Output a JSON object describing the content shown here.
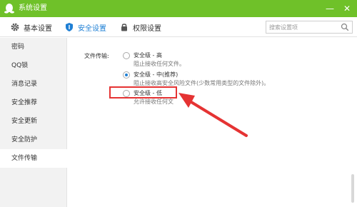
{
  "window": {
    "title": "系统设置",
    "minimize_label": "—",
    "close_label": "✕"
  },
  "tabs": [
    {
      "label": "基本设置",
      "icon": "gear-icon",
      "active": false
    },
    {
      "label": "安全设置",
      "icon": "shield-icon",
      "active": true
    },
    {
      "label": "权限设置",
      "icon": "lock-icon",
      "active": false
    }
  ],
  "search": {
    "placeholder": "搜索设置项"
  },
  "sidebar": {
    "items": [
      {
        "label": "密码"
      },
      {
        "label": "QQ锁"
      },
      {
        "label": "消息记录"
      },
      {
        "label": "安全推荐"
      },
      {
        "label": "安全更新"
      },
      {
        "label": "安全防护"
      },
      {
        "label": "文件传输",
        "active": true
      }
    ]
  },
  "file_transfer": {
    "label": "文件传输:",
    "options": [
      {
        "title": "安全级 - 高",
        "desc": "阻止接收任何文件。",
        "checked": false
      },
      {
        "title": "安全级 - 中(推荐)",
        "desc": "阻止接收高安全风险文件(少数常用类型的文件除外)。",
        "checked": true
      },
      {
        "title": "安全级 - 低",
        "desc": "允许接收任何文",
        "checked": false
      }
    ]
  },
  "colors": {
    "titlebar": "#6fc129",
    "accent": "#1e7fd4",
    "annotation": "#e53333"
  }
}
